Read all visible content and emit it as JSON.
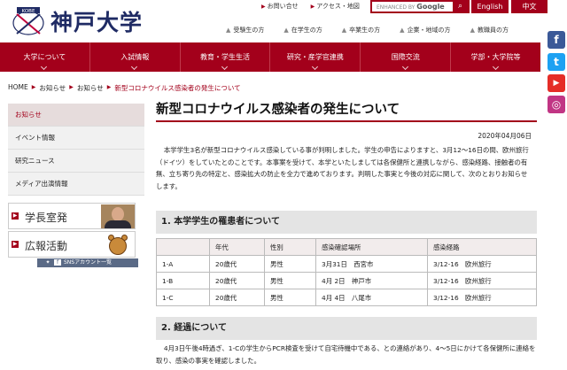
{
  "header": {
    "logo_badge": "KOBE",
    "logo_text": "神戸大学",
    "util_links": [
      "お問い合せ",
      "アクセス・地図"
    ],
    "search": {
      "placeholder_prefix": "ENHANCED BY",
      "placeholder_brand": "Google",
      "button_icon": "search-icon"
    },
    "lang": [
      "English",
      "中文"
    ],
    "sub_links": [
      "受験生の方",
      "在学生の方",
      "卒業生の方",
      "企業・地域の方",
      "教職員の方"
    ]
  },
  "nav": [
    "大学について",
    "入試情報",
    "教育・学生生活",
    "研究・産学官連携",
    "国際交流",
    "学部・大学院等"
  ],
  "social": [
    {
      "icon": "facebook-icon",
      "glyph": "f",
      "color": "#3b5998"
    },
    {
      "icon": "twitter-icon",
      "glyph": "t",
      "color": "#1da1f2"
    },
    {
      "icon": "youtube-icon",
      "glyph": "▶",
      "color": "#e52d27"
    },
    {
      "icon": "instagram-icon",
      "glyph": "◎",
      "color": "#c13584"
    }
  ],
  "breadcrumb": [
    "HOME",
    "お知らせ",
    "お知らせ",
    "新型コロナウイルス感染者の発生について"
  ],
  "sidebar": {
    "items": [
      "お知らせ",
      "イベント情報",
      "研究ニュース",
      "メディア出演情報"
    ],
    "banners": [
      "学長室発",
      "広報活動"
    ],
    "sns_label": "SNSアカウント一覧"
  },
  "main": {
    "title": "新型コロナウイルス感染者の発生について",
    "date": "2020年04月06日",
    "intro": "本学学生3名が新型コロナウイルス感染している事が判明しました。学生の申告によりますと、3月12～16日の間、欧州旅行（ドイツ）をしていたとのことです。本事案を受けて、本学といたしましては各保健所と連携しながら、感染経路、接触者の有無、立ち寄り先の特定と、感染拡大の防止を全力で進めております。判明した事実と今後の対応に関して、次のとおりお知らせします。",
    "section1": "1. 本学学生の罹患者について",
    "table": {
      "headers": [
        "",
        "年代",
        "性別",
        "感染確認場所",
        "感染経路"
      ],
      "rows": [
        [
          "1-A",
          "20歳代",
          "男性",
          "3月31日　西宮市",
          "3/12-16　欧州旅行"
        ],
        [
          "1-B",
          "20歳代",
          "男性",
          "4月 2日　神戸市",
          "3/12-16　欧州旅行"
        ],
        [
          "1-C",
          "20歳代",
          "男性",
          "4月 4日　八尾市",
          "3/12-16　欧州旅行"
        ]
      ]
    },
    "section2": "2. 経過について",
    "para2": "4月3日午後4時過ぎ、1-Cの学生からPCR検査を受けて自宅待機中である、との連絡があり、4～5日にかけて各保健所に連絡を取り、感染の事実を確認しました。"
  }
}
